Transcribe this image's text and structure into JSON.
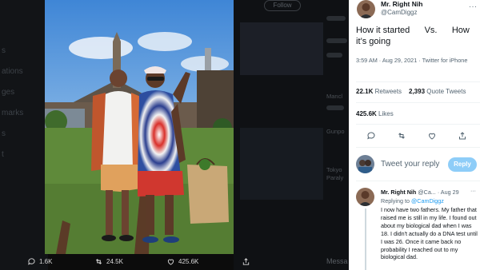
{
  "background": {
    "follow_label": "Follow",
    "nav_items": [
      "s",
      "ations",
      "ges",
      "marks",
      "s",
      "t"
    ],
    "sidebar_snippets": [
      "Mancl",
      "Gunpo",
      "Tokyo",
      "Paraly"
    ],
    "messages_label": "Messa"
  },
  "media_actions": {
    "replies": "1.6K",
    "retweets": "24.5K",
    "likes": "425.6K"
  },
  "tweet": {
    "author_name": "Mr. Right Nih",
    "author_handle": "@CamDiggz",
    "text": "How it started      Vs.      How it’s going",
    "time": "3:59 AM · Aug 29, 2021 · Twitter for iPhone",
    "retweets_count": "22.1K",
    "retweets_label": "Retweets",
    "quote_count": "2,393",
    "quote_label": "Quote Tweets",
    "likes_count": "425.6K",
    "likes_label": "Likes"
  },
  "compose": {
    "placeholder": "Tweet your reply",
    "button_label": "Reply"
  },
  "reply": {
    "author_name": "Mr. Right Nih",
    "author_handle": "@Ca...",
    "date": "· Aug 29",
    "replying_prefix": "Replying to",
    "replying_to": "@CamDiggz",
    "text": "I now have two fathers. My father that raised me is still in my life. I found out about my biological dad when I was 18. I didn't actually do a DNA test until I was 26. Once it came back no probability I reached out to my biological dad."
  },
  "colors": {
    "accent": "#1d9bf0",
    "reply_button": "#8ecdf8",
    "secondary_text": "#536471"
  }
}
